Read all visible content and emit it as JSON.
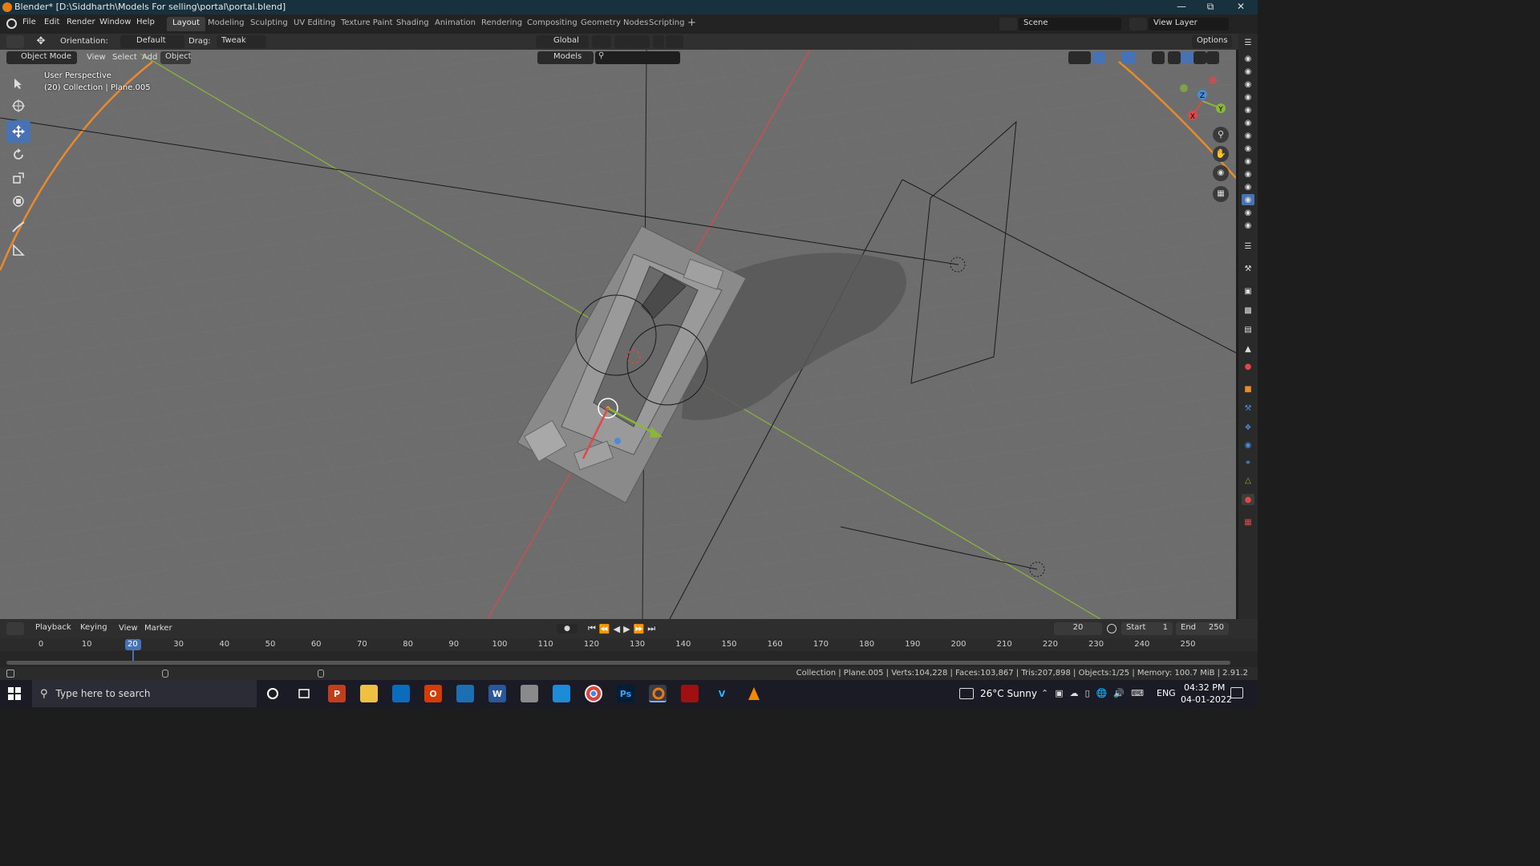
{
  "window": {
    "title": "Blender* [D:\\Siddharth\\Models For selling\\portal\\portal.blend]"
  },
  "menu": {
    "file": "File",
    "edit": "Edit",
    "render": "Render",
    "window": "Window",
    "help": "Help"
  },
  "workspaces": [
    "Layout",
    "Modeling",
    "Sculpting",
    "UV Editing",
    "Texture Paint",
    "Shading",
    "Animation",
    "Rendering",
    "Compositing",
    "Geometry Nodes",
    "Scripting"
  ],
  "active_workspace": "Layout",
  "scene": {
    "name": "Scene",
    "view_layer": "View Layer"
  },
  "tool_header": {
    "orientation_label": "Orientation:",
    "orientation_value": "Default",
    "drag_label": "Drag:",
    "drag_value": "Tweak",
    "transform_orientation": "Global",
    "options": "Options"
  },
  "viewport_header": {
    "mode": "Object Mode",
    "view": "View",
    "select": "Select",
    "add": "Add",
    "object": "Object",
    "collection_filter": "Models"
  },
  "viewport": {
    "perspective": "User Perspective",
    "context": "(20) Collection | Plane.005",
    "gizmo_axes": {
      "x": "X",
      "y": "Y",
      "z": "Z"
    }
  },
  "timeline": {
    "playback": "Playback",
    "keying": "Keying",
    "view": "View",
    "marker": "Marker",
    "current_frame": "20",
    "start_label": "Start",
    "start": "1",
    "end_label": "End",
    "end": "250",
    "ticks": [
      "0",
      "10",
      "20",
      "30",
      "40",
      "50",
      "60",
      "70",
      "80",
      "90",
      "100",
      "110",
      "120",
      "130",
      "140",
      "150",
      "160",
      "170",
      "180",
      "190",
      "200",
      "210",
      "220",
      "230",
      "240",
      "250"
    ]
  },
  "status_bar": "Collection | Plane.005 | Verts:104,228 | Faces:103,867 | Tris:207,898 | Objects:1/25 | Memory: 100.7 MiB | 2.91.2",
  "taskbar": {
    "search_placeholder": "Type here to search",
    "weather": "26°C  Sunny",
    "language": "ENG",
    "time": "04:32 PM",
    "date": "04-01-2022"
  },
  "colors": {
    "accent": "#4772b3",
    "axis_x": "#e04848",
    "axis_y": "#8ab73a",
    "axis_z": "#4d8bd8",
    "selection": "#e88a2e",
    "viewport_bg": "#6d6d6d"
  }
}
